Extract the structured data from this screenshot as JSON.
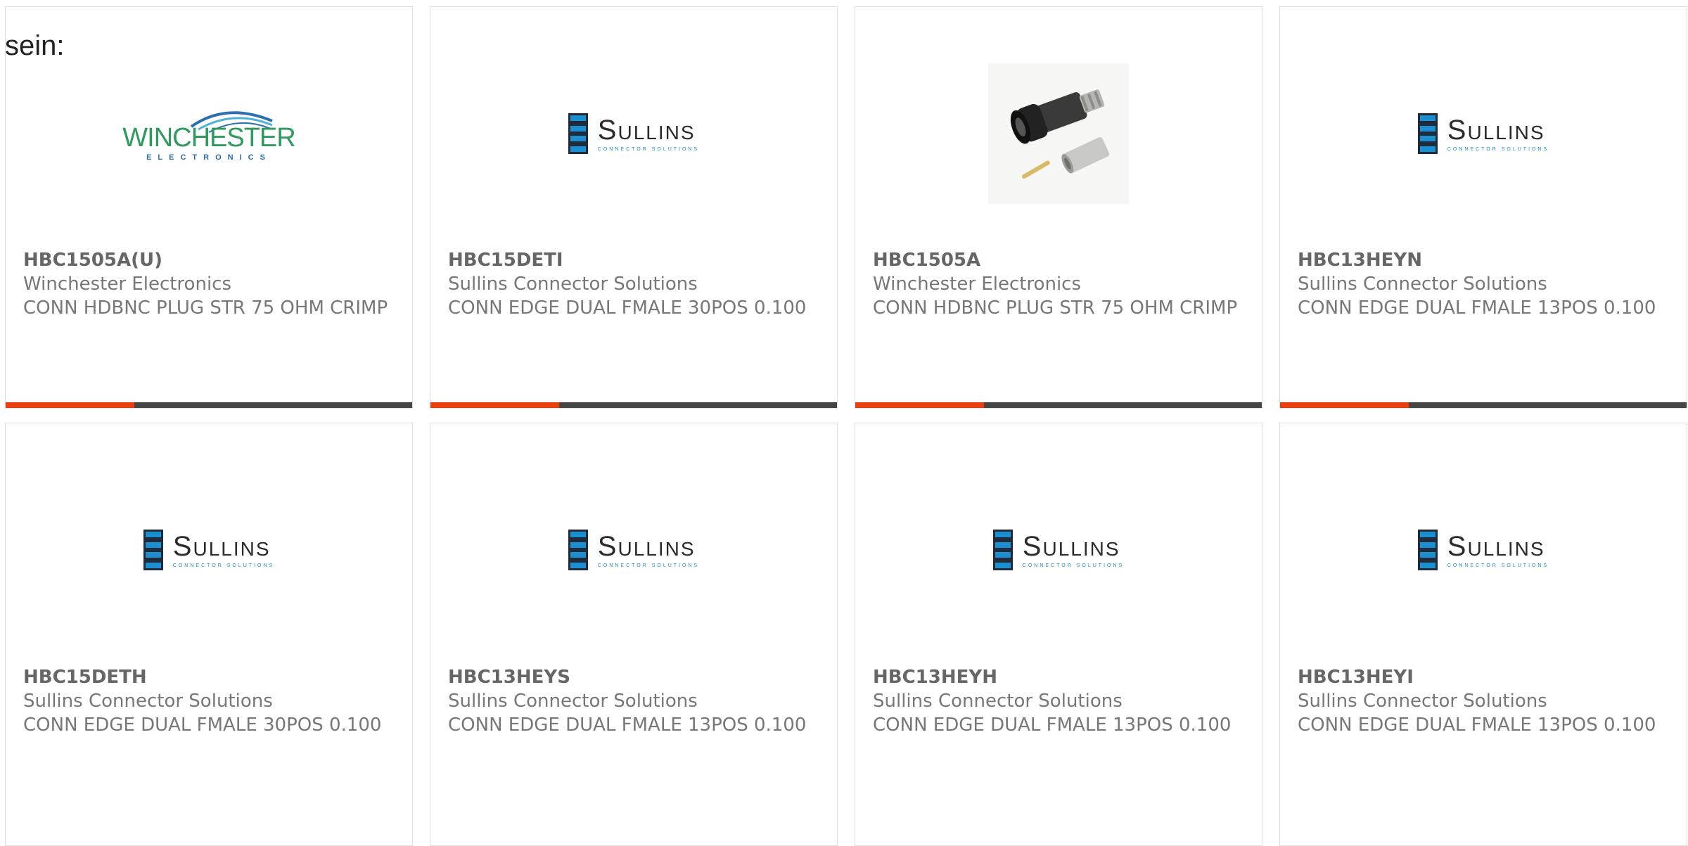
{
  "intro_text": "sein:",
  "colors": {
    "accent_bar": "#e8400c",
    "base_bar": "#444444",
    "part_text": "#666666",
    "sullins_blue": "#1c8fd0",
    "winchester_green": "#2e9a5e"
  },
  "logos": {
    "sullins_word": "Sullins",
    "sullins_sub": "Connector Solutions",
    "winchester_word": "WINCHESTER",
    "winchester_sub": "ELECTRONICS"
  },
  "products": [
    {
      "part_number": "HBC1505A(U)",
      "manufacturer": "Winchester Electronics",
      "description": "CONN HDBNC PLUG STR 75 OHM CRIMP",
      "image": "winchester-logo"
    },
    {
      "part_number": "HBC15DETI",
      "manufacturer": "Sullins Connector Solutions",
      "description": "CONN EDGE DUAL FMALE 30POS 0.100",
      "image": "sullins-logo"
    },
    {
      "part_number": "HBC1505A",
      "manufacturer": "Winchester Electronics",
      "description": "CONN HDBNC PLUG STR 75 OHM CRIMP",
      "image": "connector-photo"
    },
    {
      "part_number": "HBC13HEYN",
      "manufacturer": "Sullins Connector Solutions",
      "description": "CONN EDGE DUAL FMALE 13POS 0.100",
      "image": "sullins-logo"
    },
    {
      "part_number": "HBC15DETH",
      "manufacturer": "Sullins Connector Solutions",
      "description": "CONN EDGE DUAL FMALE 30POS 0.100",
      "image": "sullins-logo"
    },
    {
      "part_number": "HBC13HEYS",
      "manufacturer": "Sullins Connector Solutions",
      "description": "CONN EDGE DUAL FMALE 13POS 0.100",
      "image": "sullins-logo"
    },
    {
      "part_number": "HBC13HEYH",
      "manufacturer": "Sullins Connector Solutions",
      "description": "CONN EDGE DUAL FMALE 13POS 0.100",
      "image": "sullins-logo"
    },
    {
      "part_number": "HBC13HEYI",
      "manufacturer": "Sullins Connector Solutions",
      "description": "CONN EDGE DUAL FMALE 13POS 0.100",
      "image": "sullins-logo"
    }
  ]
}
